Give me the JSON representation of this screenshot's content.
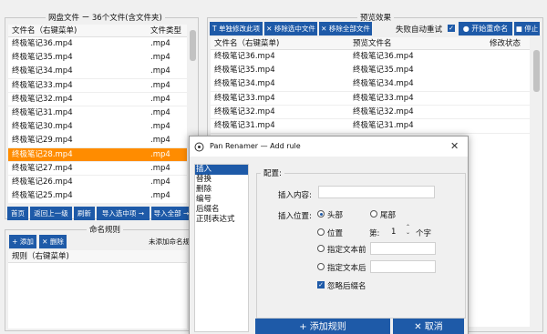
{
  "left_panel": {
    "title": "网盘文件 ー 36个文件(含文件夹)",
    "col_name": "文件名（右键菜单)",
    "col_type": "文件类型",
    "files": [
      {
        "name": "终极笔记36.mp4",
        "type": ".mp4"
      },
      {
        "name": "终极笔记35.mp4",
        "type": ".mp4"
      },
      {
        "name": "终极笔记34.mp4",
        "type": ".mp4"
      },
      {
        "name": "终极笔记33.mp4",
        "type": ".mp4"
      },
      {
        "name": "终极笔记32.mp4",
        "type": ".mp4"
      },
      {
        "name": "终极笔记31.mp4",
        "type": ".mp4"
      },
      {
        "name": "终极笔记30.mp4",
        "type": ".mp4"
      },
      {
        "name": "终极笔记29.mp4",
        "type": ".mp4"
      },
      {
        "name": "终极笔记28.mp4",
        "type": ".mp4"
      },
      {
        "name": "终极笔记27.mp4",
        "type": ".mp4"
      },
      {
        "name": "终极笔记26.mp4",
        "type": ".mp4"
      },
      {
        "name": "终极笔记25.mp4",
        "type": ".mp4"
      }
    ],
    "selected_index": 8,
    "buttons": {
      "home": "首页",
      "up": "返回上一级",
      "refresh": "刷新",
      "import_selected": "导入选中项 →",
      "import_all": "导入全部 →"
    }
  },
  "rules_panel": {
    "title": "命名规则",
    "add": "+ 添加",
    "delete": "✕ 删除",
    "status": "未添加命名规则",
    "col_rule": "规则（右键菜单)"
  },
  "preview_panel": {
    "title": "预览效果",
    "btn_manual": "T 单独修改此项",
    "btn_remove_selected": "✕ 移除选中文件",
    "btn_remove_all": "✕ 移除全部文件",
    "auto_retry": "失败自动重试",
    "start": "● 开始重命名",
    "stop": "■ 停止",
    "col_name": "文件名（右键菜单)",
    "col_preview": "预览文件名",
    "col_status": "修改状态",
    "rows": [
      {
        "name": "终极笔记36.mp4",
        "preview": "终极笔记36.mp4"
      },
      {
        "name": "终极笔记35.mp4",
        "preview": "终极笔记35.mp4"
      },
      {
        "name": "终极笔记34.mp4",
        "preview": "终极笔记34.mp4"
      },
      {
        "name": "终极笔记33.mp4",
        "preview": "终极笔记33.mp4"
      },
      {
        "name": "终极笔记32.mp4",
        "preview": "终极笔记32.mp4"
      },
      {
        "name": "终极笔记31.mp4",
        "preview": "终极笔记31.mp4"
      }
    ]
  },
  "dialog": {
    "title": "Pan Renamer — Add rule",
    "rule_types": [
      "插入",
      "替换",
      "删除",
      "编号",
      "后缀名",
      "正则表达式"
    ],
    "selected_rule_index": 0,
    "config_label": "配置:",
    "insert_content_label": "插入内容:",
    "insert_content_value": "",
    "insert_pos_label": "插入位置:",
    "pos_head": "头部",
    "pos_tail": "尾部",
    "pos_index": "位置",
    "pos_index_prefix": "第:",
    "pos_index_value": "1",
    "pos_index_suffix": "个字",
    "pos_before": "指定文本前",
    "pos_after": "指定文本后",
    "ignore_ext": "忽略后缀名",
    "add_rule": "+ 添加规则",
    "cancel": "✕ 取消"
  },
  "colors": {
    "accent": "#1e5aa8",
    "selected_row": "#ff8c00"
  }
}
